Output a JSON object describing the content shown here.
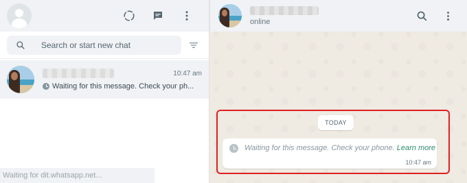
{
  "left_header": {
    "icons": [
      "avatar",
      "status-icon",
      "new-chat-icon",
      "menu-dots-icon"
    ]
  },
  "search": {
    "placeholder": "Search or start new chat"
  },
  "chat_list": [
    {
      "time": "10:47 am",
      "preview": "Waiting for this message. Check your ph..."
    }
  ],
  "status_bar": {
    "text": "Waiting for dit.whatsapp.net..."
  },
  "conversation": {
    "contact_status": "online",
    "date_divider": "TODAY",
    "message": {
      "text": "Waiting for this message. Check your phone.",
      "link": "Learn more",
      "time": "10:47 am"
    }
  },
  "colors": {
    "highlight_border": "#e01e1e",
    "link": "#2e8b6e",
    "chat_background": "#efeae2",
    "header_background": "#f0f2f5"
  }
}
